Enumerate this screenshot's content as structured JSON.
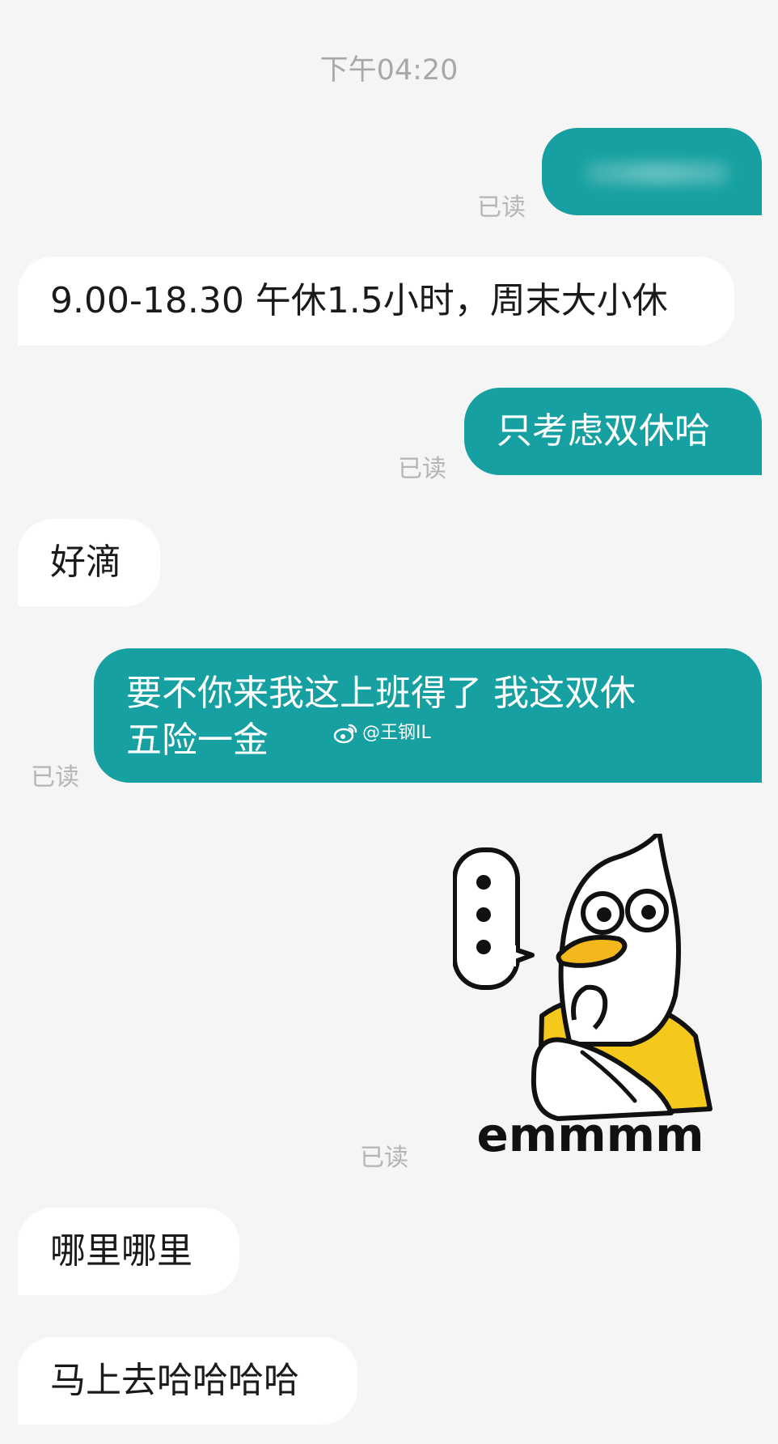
{
  "chat": {
    "timestamp": "下午04:20",
    "read_label": "已读",
    "watermark": "@王钢IL",
    "sticker_text": "emmmm",
    "messages": {
      "m1": {
        "text": "",
        "direction": "out",
        "redacted": true
      },
      "m2": {
        "text": "9.00-18.30 午休1.5小时，周末大小休",
        "direction": "in"
      },
      "m3": {
        "text": "只考虑双休哈",
        "direction": "out"
      },
      "m4": {
        "text": "好滴",
        "direction": "in"
      },
      "m5": {
        "line1": "要不你来我这上班得了 我这双休",
        "line2": "五险一金",
        "direction": "out"
      },
      "m6": {
        "type": "sticker",
        "direction": "out"
      },
      "m7": {
        "text": "哪里哪里",
        "direction": "in"
      },
      "m8": {
        "text": "马上去哈哈哈哈",
        "direction": "in"
      }
    }
  },
  "colors": {
    "background": "#f5f5f5",
    "outgoing_bubble": "#16a0a1",
    "incoming_bubble": "#ffffff",
    "read_text": "#b5b5b5"
  }
}
